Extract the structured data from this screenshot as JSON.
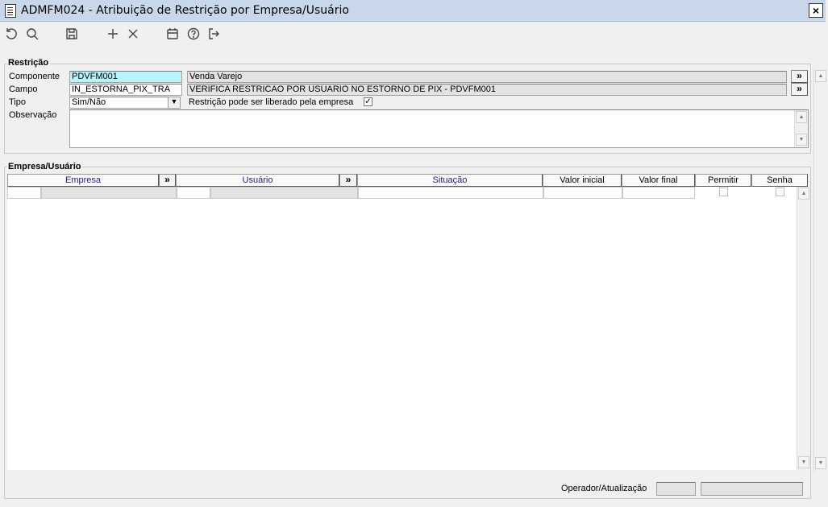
{
  "window": {
    "title": "ADMFM024 - Atribuição de Restrição por Empresa/Usuário",
    "close_label": "×"
  },
  "toolbar": {
    "buttons": [
      "refresh-icon",
      "search-icon",
      "save-icon",
      "add-icon",
      "delete-icon",
      "calendar-icon",
      "help-icon",
      "exit-icon"
    ]
  },
  "restricao": {
    "legend": "Restrição",
    "componente_label": "Componente",
    "componente_value": "PDVFM001",
    "componente_desc": "Venda Varejo",
    "campo_label": "Campo",
    "campo_value": "IN_ESTORNA_PIX_TRA",
    "campo_desc": "VERIFICA RESTRICAO POR USUARIO NO ESTORNO DE PIX - PDVFM001",
    "tipo_label": "Tipo",
    "tipo_value": "Sim/Não",
    "liberado_label": "Restrição pode ser liberado pela empresa",
    "liberado_checked": true,
    "observacao_label": "Observação",
    "observacao_value": "",
    "lookup_label": "»"
  },
  "empresa_usuario": {
    "legend": "Empresa/Usuário",
    "columns": {
      "empresa": "Empresa",
      "usuario": "Usuário",
      "situacao": "Situação",
      "valor_inicial": "Valor inicial",
      "valor_final": "Valor final",
      "permitir": "Permitir",
      "senha": "Senha"
    },
    "lookup_label": "»",
    "rows": [
      {
        "empresa_cod": "",
        "empresa_nome": "",
        "usuario_cod": "",
        "usuario_nome": "",
        "situacao": "",
        "valor_inicial": "",
        "valor_final": "",
        "permitir": false,
        "senha": false
      }
    ]
  },
  "footer": {
    "operador_label": "Operador/Atualização",
    "operador_value": "",
    "atualizacao_value": ""
  },
  "colors": {
    "titlebar": "#c8d8ea",
    "highlight_input": "#b7f5fb",
    "header_text": "#1a1a8c"
  }
}
